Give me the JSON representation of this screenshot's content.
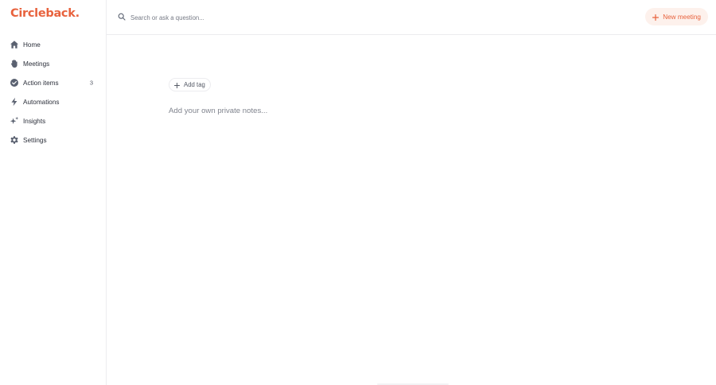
{
  "brand": {
    "logo_text": "Circleback.",
    "accent": "#e8623d"
  },
  "sidebar": {
    "items": [
      {
        "label": "Home",
        "icon": "home-icon",
        "badge": ""
      },
      {
        "label": "Meetings",
        "icon": "meetings-hand-icon",
        "badge": ""
      },
      {
        "label": "Action items",
        "icon": "check-circle-icon",
        "badge": "3"
      },
      {
        "label": "Automations",
        "icon": "lightning-icon",
        "badge": ""
      },
      {
        "label": "Insights",
        "icon": "sparkles-icon",
        "badge": ""
      },
      {
        "label": "Settings",
        "icon": "gear-icon",
        "badge": ""
      }
    ]
  },
  "topbar": {
    "search_placeholder": "Search or ask a question...",
    "new_meeting_label": "New meeting"
  },
  "main": {
    "add_tag_label": "Add tag",
    "notes_placeholder": "Add your own private notes..."
  }
}
